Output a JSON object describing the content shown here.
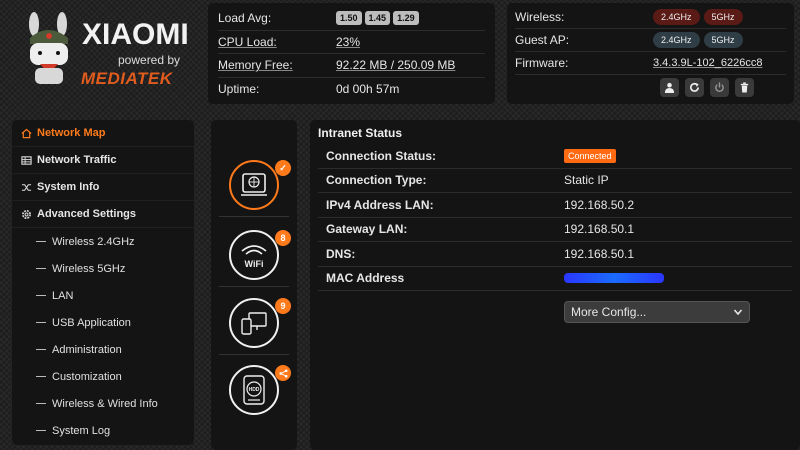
{
  "logo": {
    "brand": "XIAOMI",
    "powered": "powered by",
    "chip": "MEDIATEK"
  },
  "stats": [
    {
      "label": "Load Avg:",
      "pills": [
        "1.50",
        "1.45",
        "1.29"
      ]
    },
    {
      "label": "CPU Load:",
      "value": "23%"
    },
    {
      "label": "Memory Free:",
      "value": "92.22 MB / 250.09 MB"
    },
    {
      "label": "Uptime:",
      "value": "0d 00h 57m"
    }
  ],
  "wireless": {
    "wireless_label": "Wireless:",
    "guest_label": "Guest AP:",
    "band_24": "2.4GHz",
    "band_5": "5GHz",
    "firmware_label": "Firmware:",
    "firmware_value": "3.4.3.9L-102_6226cc8",
    "actions": [
      "user-icon",
      "refresh-icon",
      "power-icon",
      "trash-icon"
    ]
  },
  "sidebar": {
    "main": [
      {
        "label": "Network Map",
        "icon": "home-icon",
        "active": true
      },
      {
        "label": "Network Traffic",
        "icon": "traffic-icon"
      },
      {
        "label": "System Info",
        "icon": "shuffle-icon"
      },
      {
        "label": "Advanced Settings",
        "icon": "gear-icon"
      }
    ],
    "sub": [
      "Wireless 2.4GHz",
      "Wireless 5GHz",
      "LAN",
      "USB Application",
      "Administration",
      "Customization",
      "Wireless & Wired Info",
      "System Log"
    ]
  },
  "devices": {
    "router_badge": "✓",
    "wifi_text": "WiFi",
    "wifi_badge": "8",
    "clients_badge": "9",
    "hdd_text": "HDD"
  },
  "intranet": {
    "title": "Intranet Status",
    "rows": [
      {
        "label": "Connection Status:",
        "value": "Connected"
      },
      {
        "label": "Connection Type:",
        "value": "Static IP"
      },
      {
        "label": "IPv4 Address LAN:",
        "value": "192.168.50.2"
      },
      {
        "label": "Gateway LAN:",
        "value": "192.168.50.1"
      },
      {
        "label": "DNS:",
        "value": "192.168.50.1"
      },
      {
        "label": "MAC Address",
        "value": ""
      }
    ],
    "more_config": "More Config..."
  },
  "colors": {
    "accent": "#ff7a1a",
    "panel": "#141414",
    "band_on": "#5a1a16",
    "band_off": "#2f3d46"
  }
}
